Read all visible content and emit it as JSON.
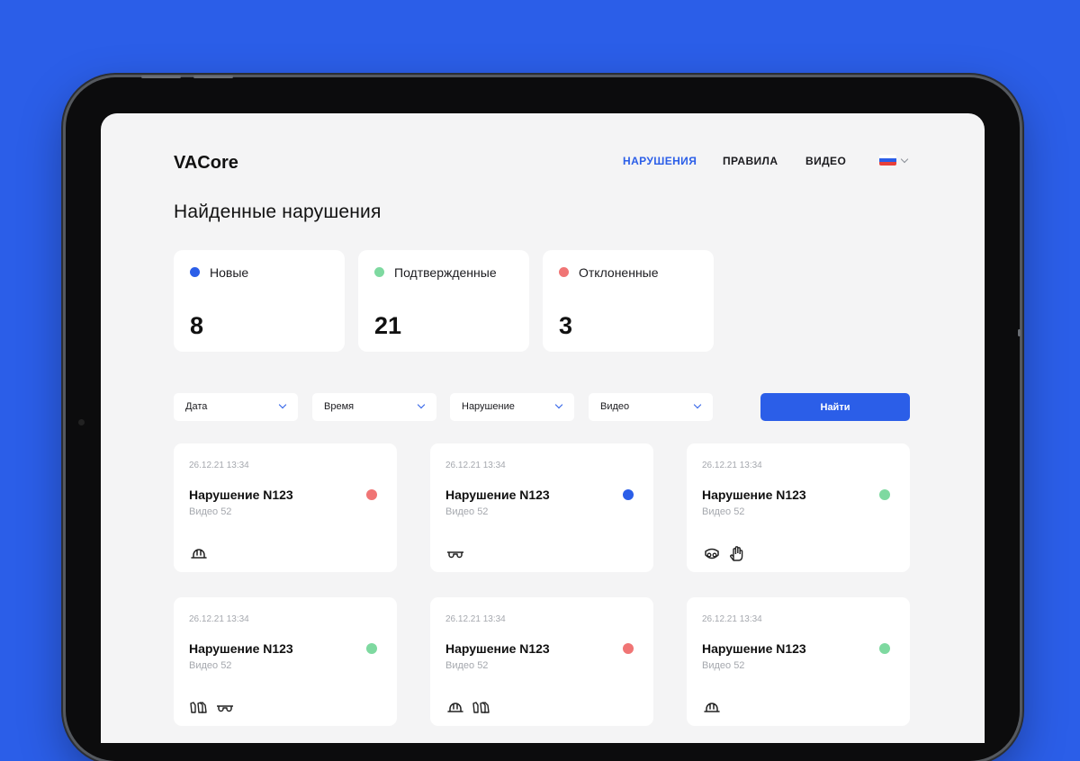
{
  "app": {
    "logo": "VACore"
  },
  "nav": {
    "items": [
      {
        "label": "НАРУШЕНИЯ",
        "active": true
      },
      {
        "label": "ПРАВИЛА",
        "active": false
      },
      {
        "label": "ВИДЕО",
        "active": false
      }
    ],
    "language": {
      "flag": "ru"
    }
  },
  "page": {
    "title": "Найденные нарушения"
  },
  "colors": {
    "accent": "#2B5EE8",
    "new": "#2B5EE8",
    "confirmed": "#7ED9A0",
    "rejected": "#F07575"
  },
  "stats": [
    {
      "label": "Новые",
      "value": "8",
      "status": "new"
    },
    {
      "label": "Подтвержденные",
      "value": "21",
      "status": "confirmed"
    },
    {
      "label": "Отклоненные",
      "value": "3",
      "status": "rejected"
    }
  ],
  "filters": [
    {
      "label": "Дата"
    },
    {
      "label": "Время"
    },
    {
      "label": "Нарушение"
    },
    {
      "label": "Видео"
    }
  ],
  "search_button": "Найти",
  "violations": [
    {
      "date": "26.12.21 13:34",
      "title": "Нарушение N123",
      "video": "Видео 52",
      "status": "rejected",
      "icons": [
        "helmet-icon"
      ]
    },
    {
      "date": "26.12.21 13:34",
      "title": "Нарушение N123",
      "video": "Видео 52",
      "status": "new",
      "icons": [
        "goggles-icon"
      ]
    },
    {
      "date": "26.12.21 13:34",
      "title": "Нарушение N123",
      "video": "Видео 52",
      "status": "confirmed",
      "icons": [
        "respirator-icon",
        "glove-icon"
      ]
    },
    {
      "date": "26.12.21 13:34",
      "title": "Нарушение N123",
      "video": "Видео 52",
      "status": "confirmed",
      "icons": [
        "boots-icon",
        "goggles-icon"
      ]
    },
    {
      "date": "26.12.21 13:34",
      "title": "Нарушение N123",
      "video": "Видео 52",
      "status": "rejected",
      "icons": [
        "helmet-icon",
        "boots-icon"
      ]
    },
    {
      "date": "26.12.21 13:34",
      "title": "Нарушение N123",
      "video": "Видео 52",
      "status": "confirmed",
      "icons": [
        "helmet-icon"
      ]
    }
  ]
}
